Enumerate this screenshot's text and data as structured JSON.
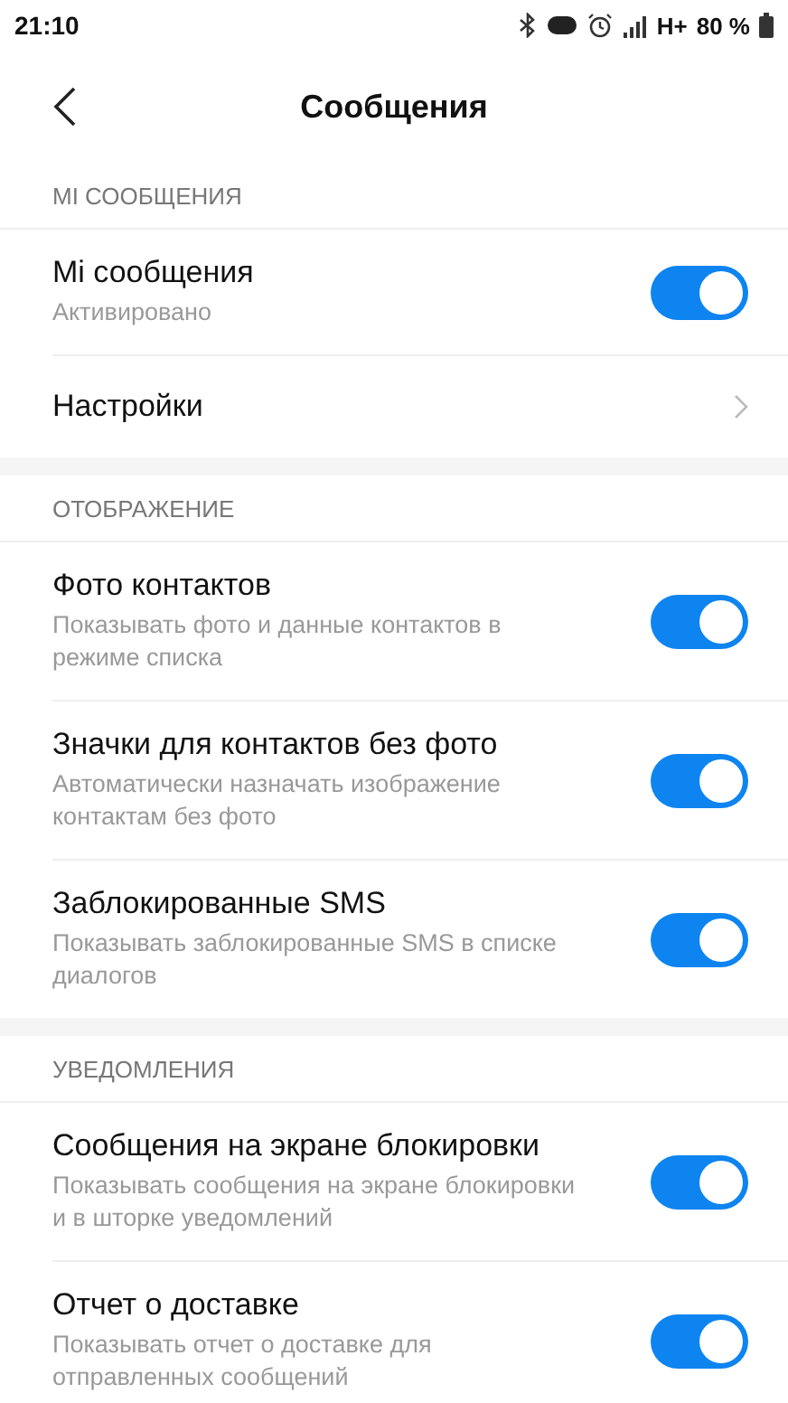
{
  "status_bar": {
    "time": "21:10",
    "network": "H+",
    "battery": "80 %"
  },
  "header": {
    "title": "Сообщения"
  },
  "sections": [
    {
      "title": "MI СООБЩЕНИЯ",
      "items": [
        {
          "kind": "toggle",
          "title": "Mi сообщения",
          "subtitle": "Активировано",
          "on": true
        },
        {
          "kind": "link",
          "title": "Настройки"
        }
      ]
    },
    {
      "title": "ОТОБРАЖЕНИЕ",
      "items": [
        {
          "kind": "toggle",
          "title": "Фото контактов",
          "subtitle": "Показывать фото и данные контактов в режиме списка",
          "on": true
        },
        {
          "kind": "toggle",
          "title": "Значки для контактов без фото",
          "subtitle": "Автоматически назначать изображение контактам без фото",
          "on": true
        },
        {
          "kind": "toggle",
          "title": "Заблокированные SMS",
          "subtitle": "Показывать заблокированные SMS в списке диалогов",
          "on": true
        }
      ]
    },
    {
      "title": "УВЕДОМЛЕНИЯ",
      "items": [
        {
          "kind": "toggle",
          "title": "Сообщения на экране блокировки",
          "subtitle": "Показывать сообщения на экране блокировки и в шторке уведомлений",
          "on": true
        },
        {
          "kind": "toggle",
          "title": "Отчет о доставке",
          "subtitle": "Показывать отчет о доставке для отправленных сообщений",
          "on": true
        }
      ]
    }
  ]
}
